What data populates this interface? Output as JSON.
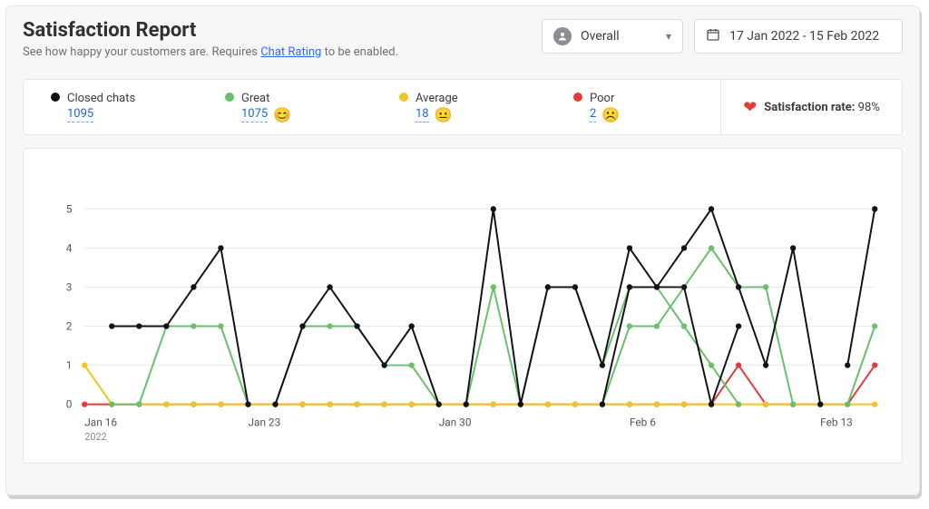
{
  "header": {
    "title": "Satisfaction Report",
    "subtitle_prefix": "See how happy your customers are. Requires ",
    "subtitle_link": "Chat Rating",
    "subtitle_suffix": " to be enabled."
  },
  "controls": {
    "scope": {
      "label": "Overall"
    },
    "date_range": {
      "label": "17 Jan 2022 - 15 Feb 2022"
    }
  },
  "summary": {
    "closed": {
      "label": "Closed chats",
      "value": "1095",
      "color": "#111417",
      "emoji": ""
    },
    "great": {
      "label": "Great",
      "value": "1075",
      "color": "#68c06b",
      "emoji": "😊"
    },
    "average": {
      "label": "Average",
      "value": "18",
      "color": "#f3c321",
      "emoji": "😐"
    },
    "poor": {
      "label": "Poor",
      "value": "2",
      "color": "#e43a3a",
      "emoji": "☹️"
    },
    "satisfaction": {
      "label": "Satisfaction rate:",
      "value": "98%"
    }
  },
  "chart_data": {
    "type": "line",
    "ylabel": "",
    "xlabel": "",
    "ylim": [
      0,
      5
    ],
    "y_ticks": [
      0,
      1,
      2,
      3,
      4,
      5
    ],
    "x_ticks": [
      {
        "label": "Jan 16",
        "sublabel": "2022",
        "index": 0
      },
      {
        "label": "Jan 23",
        "index": 6
      },
      {
        "label": "Jan 30",
        "index": 13
      },
      {
        "label": "Feb 6",
        "index": 20
      },
      {
        "label": "Feb 13",
        "index": 27
      }
    ],
    "categories_count": 30,
    "series": [
      {
        "name": "Closed chats",
        "key": "closed",
        "segments": [
          [
            2,
            2,
            2,
            3,
            4,
            0
          ],
          [
            0,
            2,
            3,
            2,
            1,
            2,
            0
          ],
          [
            0,
            5,
            0,
            3,
            3,
            1,
            4,
            3,
            3,
            0,
            2
          ],
          [
            0,
            3,
            3,
            4,
            5,
            3,
            1,
            4,
            0
          ],
          [
            1,
            5
          ]
        ],
        "segment_starts": [
          1,
          7,
          14,
          19,
          28
        ]
      },
      {
        "name": "Great",
        "key": "great",
        "segments": [
          [
            0,
            0,
            2,
            2,
            2,
            0
          ],
          [
            0,
            2,
            2,
            2,
            1,
            1,
            0
          ],
          [
            0,
            3,
            0,
            3,
            3,
            1,
            3,
            3,
            2,
            1,
            0
          ],
          [
            0,
            2,
            2,
            3,
            4,
            3,
            3,
            0
          ],
          [
            0,
            2
          ]
        ],
        "segment_starts": [
          1,
          7,
          14,
          19,
          28
        ]
      },
      {
        "name": "Average",
        "key": "avg",
        "segments": [
          [
            1,
            0,
            0,
            0,
            0,
            0,
            0,
            0,
            0,
            0,
            0,
            0,
            0,
            0,
            0,
            0,
            0,
            0,
            0,
            0,
            0,
            0,
            0,
            0,
            0,
            0,
            0,
            0,
            0,
            0
          ]
        ],
        "segment_starts": [
          0
        ]
      },
      {
        "name": "Poor",
        "key": "poor",
        "segments": [
          [
            0,
            0,
            0,
            0,
            0,
            0,
            0,
            0,
            0,
            0,
            0,
            0,
            0,
            0,
            0,
            0,
            0,
            0,
            0,
            0,
            0,
            0,
            0,
            0,
            1,
            0,
            0,
            0,
            0,
            1
          ]
        ],
        "segment_starts": [
          0
        ]
      }
    ]
  }
}
